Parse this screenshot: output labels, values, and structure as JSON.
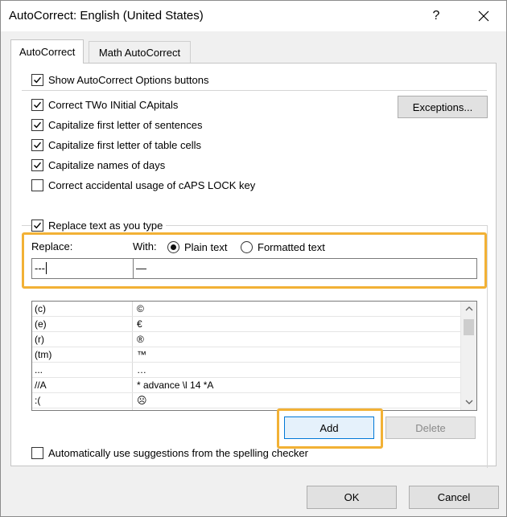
{
  "window": {
    "title": "AutoCorrect: English (United States)",
    "help_label": "?"
  },
  "tabs": [
    {
      "label": "AutoCorrect",
      "active": true
    },
    {
      "label": "Math AutoCorrect",
      "active": false
    }
  ],
  "options": {
    "show_buttons": {
      "label": "Show AutoCorrect Options buttons",
      "checked": true
    },
    "two_initial": {
      "label": "Correct TWo INitial CApitals",
      "checked": true
    },
    "first_sentence": {
      "label": "Capitalize first letter of sentences",
      "checked": true
    },
    "first_table": {
      "label": "Capitalize first letter of table cells",
      "checked": true
    },
    "names_days": {
      "label": "Capitalize names of days",
      "checked": true
    },
    "caps_lock": {
      "label": "Correct accidental usage of cAPS LOCK key",
      "checked": false
    },
    "replace_text": {
      "label": "Replace text as you type",
      "checked": true
    },
    "spelling_suggest": {
      "label": "Automatically use suggestions from the spelling checker",
      "checked": false
    }
  },
  "exceptions_label": "Exceptions...",
  "replace": {
    "replace_label": "Replace:",
    "with_label": "With:",
    "plain_text_label": "Plain text",
    "formatted_text_label": "Formatted text",
    "selected_format": "plain",
    "replace_value": "---",
    "with_value": "—"
  },
  "entries": [
    {
      "from": "(c)",
      "to": "©"
    },
    {
      "from": "(e)",
      "to": "€"
    },
    {
      "from": "(r)",
      "to": "®"
    },
    {
      "from": "(tm)",
      "to": "™"
    },
    {
      "from": "...",
      "to": "…"
    },
    {
      "from": "//A",
      "to": "* advance \\l 14 *A"
    },
    {
      "from": ":(",
      "to": "☹"
    }
  ],
  "buttons": {
    "add": "Add",
    "delete": "Delete",
    "ok": "OK",
    "cancel": "Cancel"
  },
  "colors": {
    "highlight": "#f2b135"
  }
}
